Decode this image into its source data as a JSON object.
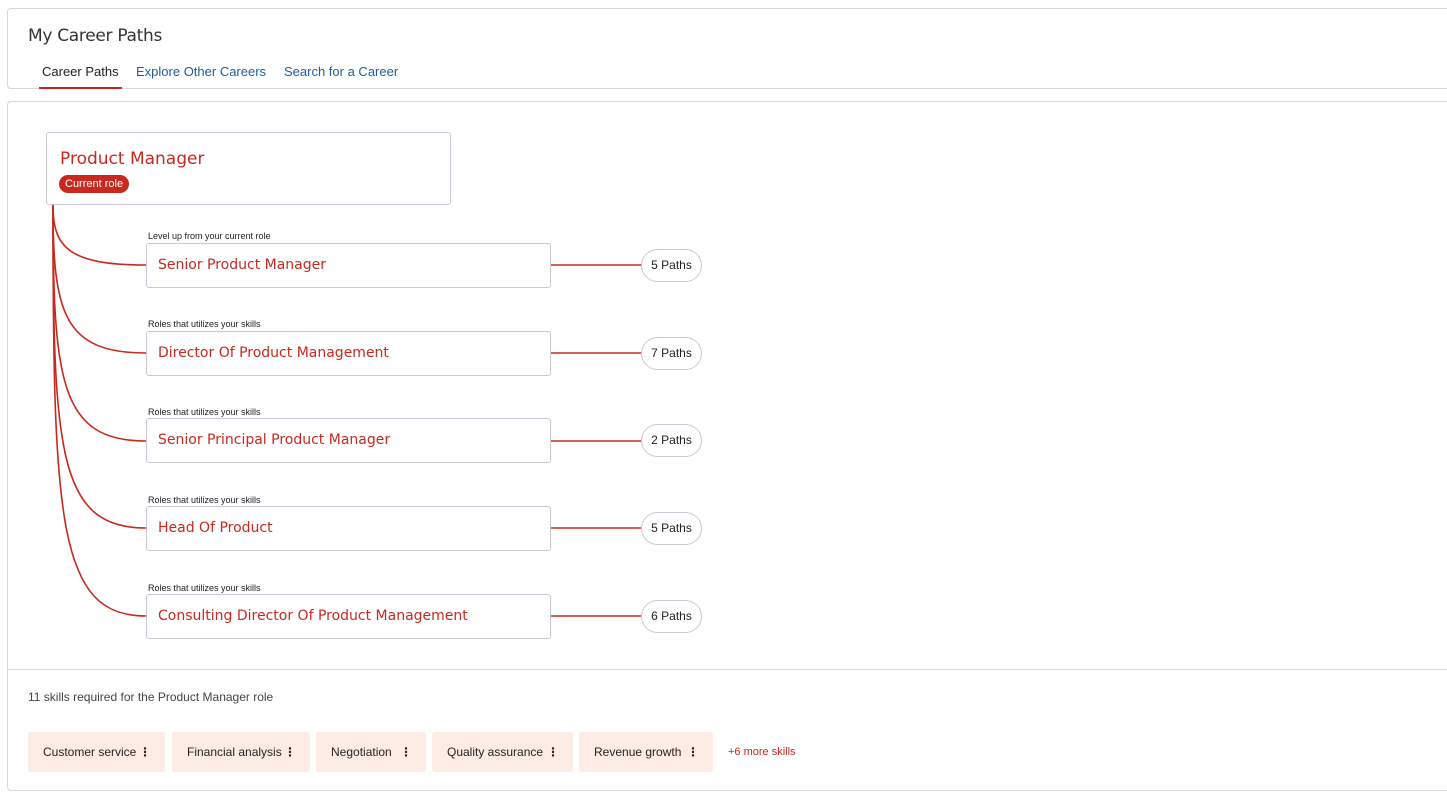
{
  "header": {
    "title": "My Career Paths",
    "tabs": [
      {
        "label": "Career Paths",
        "active": true
      },
      {
        "label": "Explore Other Careers",
        "active": false
      },
      {
        "label": "Search for a Career",
        "active": false
      }
    ]
  },
  "current_role": {
    "title": "Product Manager",
    "badge": "Current role"
  },
  "roles": [
    {
      "caption": "Level up from your current role",
      "title": "Senior Product Manager",
      "paths": "5 Paths"
    },
    {
      "caption": "Roles that utilizes your skills",
      "title": "Director Of Product Management",
      "paths": "7 Paths"
    },
    {
      "caption": "Roles that utilizes your skills",
      "title": "Senior Principal Product Manager",
      "paths": "2 Paths"
    },
    {
      "caption": "Roles that utilizes your skills",
      "title": "Head Of Product",
      "paths": "5 Paths"
    },
    {
      "caption": "Roles that utilizes your skills",
      "title": "Consulting Director Of Product Management",
      "paths": "6 Paths"
    }
  ],
  "skills": {
    "heading": "11 skills required for the Product Manager role",
    "chips": [
      {
        "label": "Customer service"
      },
      {
        "label": "Financial analysis"
      },
      {
        "label": "Negotiation"
      },
      {
        "label": "Quality assurance"
      },
      {
        "label": "Revenue growth"
      }
    ],
    "more_label": "+6 more skills",
    "kebab": "⋮"
  },
  "colors": {
    "accent": "#c8291f",
    "link": "#1f5e99",
    "chip_bg": "#fdece6",
    "border": "#c9c9d6"
  }
}
